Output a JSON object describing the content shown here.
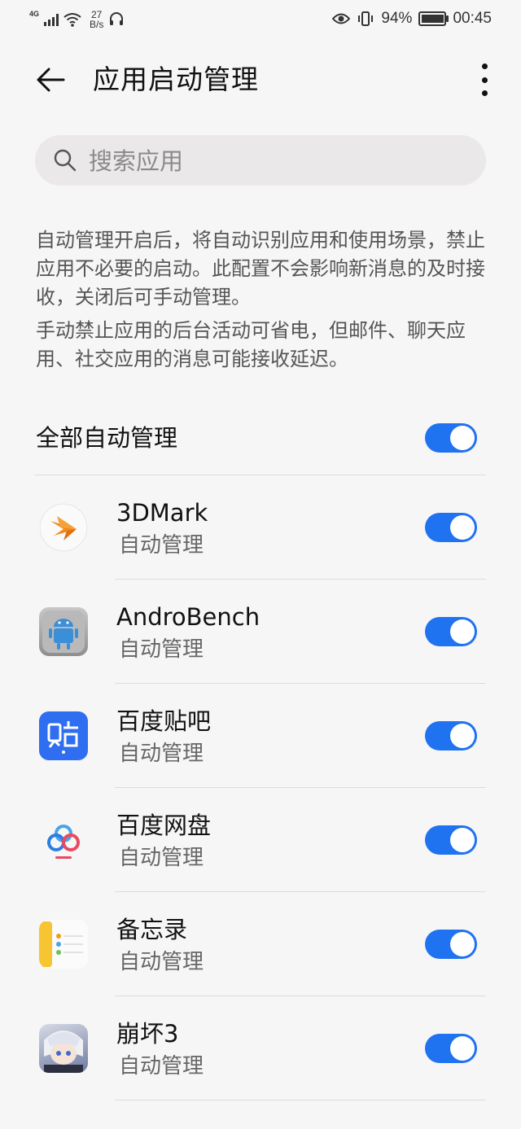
{
  "status_bar": {
    "network": "4G",
    "speed_value": "27",
    "speed_unit": "B/s",
    "battery": "94%",
    "time": "00:45"
  },
  "header": {
    "title": "应用启动管理"
  },
  "search": {
    "placeholder": "搜索应用"
  },
  "description": {
    "p1": "自动管理开启后，将自动识别应用和使用场景，禁止应用不必要的启动。此配置不会影响新消息的及时接收，关闭后可手动管理。",
    "p2": "手动禁止应用的后台活动可省电，但邮件、聊天应用、社交应用的消息可能接收延迟。"
  },
  "all_toggle": {
    "label": "全部自动管理",
    "on": true
  },
  "apps": [
    {
      "name": "3DMark",
      "status": "自动管理",
      "on": true,
      "icon": "3dmark-icon"
    },
    {
      "name": "AndroBench",
      "status": "自动管理",
      "on": true,
      "icon": "androbench-icon"
    },
    {
      "name": "百度贴吧",
      "status": "自动管理",
      "on": true,
      "icon": "baidu-tieba-icon"
    },
    {
      "name": "百度网盘",
      "status": "自动管理",
      "on": true,
      "icon": "baidu-netdisk-icon"
    },
    {
      "name": "备忘录",
      "status": "自动管理",
      "on": true,
      "icon": "memo-icon"
    },
    {
      "name": "崩坏3",
      "status": "自动管理",
      "on": true,
      "icon": "honkai3-icon"
    }
  ],
  "colors": {
    "toggle_on": "#1f72f0",
    "background": "#f6f6f6"
  }
}
